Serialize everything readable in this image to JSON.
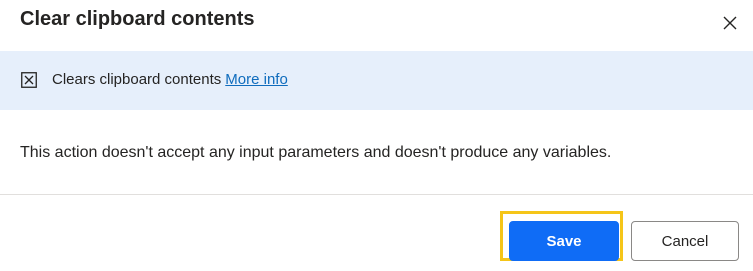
{
  "dialog": {
    "title": "Clear clipboard contents",
    "close_icon": "close-icon"
  },
  "info_bar": {
    "icon": "clipboard-x-icon",
    "text": "Clears clipboard contents",
    "link_text": "More info"
  },
  "body": {
    "message": "This action doesn't accept any input parameters and doesn't produce any variables."
  },
  "footer": {
    "save_label": "Save",
    "cancel_label": "Cancel"
  },
  "colors": {
    "primary": "#0f6cf6",
    "info_background": "#e6effb",
    "link": "#0f6cbd",
    "focus_outline": "#f5c518"
  }
}
